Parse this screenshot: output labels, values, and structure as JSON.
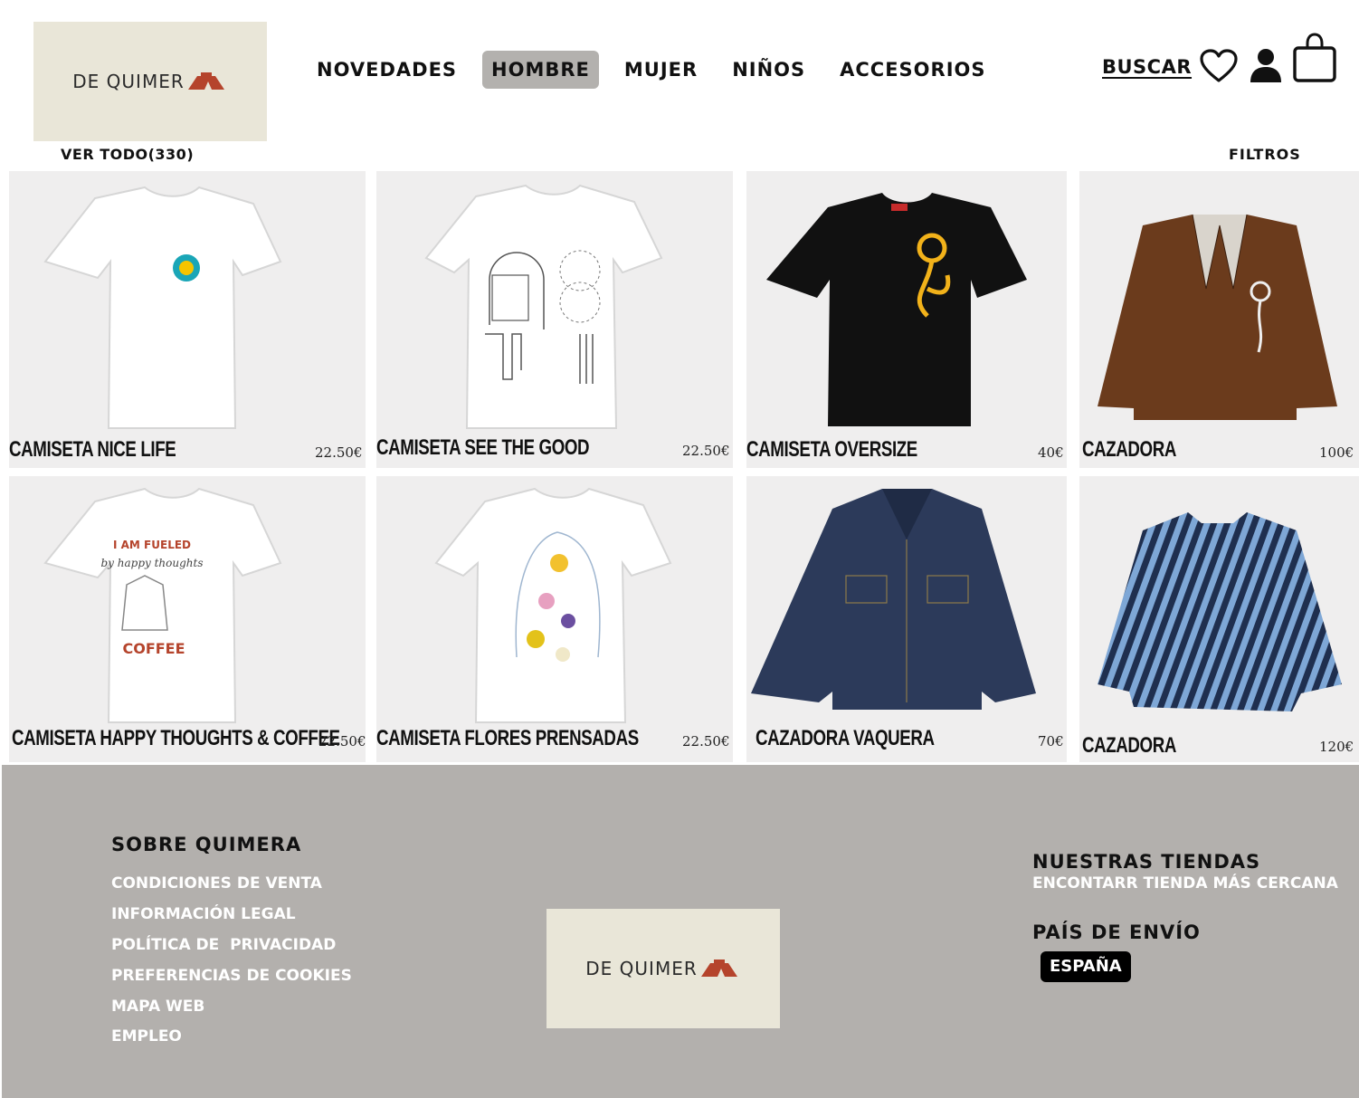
{
  "brand": {
    "logo_text": "DE QUIMER",
    "accent": "#b5442c",
    "logo_bg": "#e9e6d8"
  },
  "nav": {
    "items": [
      "NOVEDADES",
      "HOMBRE",
      "MUJER",
      "NIÑOS",
      "ACCESORIOS"
    ],
    "active": "HOMBRE"
  },
  "header": {
    "search_label": "BUSCAR",
    "icons": [
      "heart-icon",
      "user-icon",
      "shopping-bag-icon"
    ]
  },
  "listing": {
    "view_all_label": "VER TODO(330)",
    "filters_label": "FILTROS"
  },
  "products": [
    {
      "name": "CAMISETA NICE LIFE",
      "price": "22.50€",
      "image": "white-tshirt-smiley-badge"
    },
    {
      "name": "CAMISETA SEE THE GOOD",
      "price": "22.50€",
      "image": "white-tshirt-see-the-good-print"
    },
    {
      "name": "CAMISETA OVERSIZE",
      "price": "40€",
      "image": "black-tshirt-yellow-flower"
    },
    {
      "name": "CAZADORA",
      "price": "100€",
      "image": "brown-jacket-flower"
    },
    {
      "name": "CAMISETA HAPPY THOUGHTS & COFFEE",
      "price": "22.50€",
      "image": "white-tshirt-coffee-print"
    },
    {
      "name": "CAMISETA FLORES PRENSADAS",
      "price": "22.50€",
      "image": "white-tshirt-pressed-flowers"
    },
    {
      "name": "CAZADORA VAQUERA",
      "price": "70€",
      "image": "denim-jacket"
    },
    {
      "name": "CAZADORA",
      "price": "120€",
      "image": "striped-denim-jacket"
    }
  ],
  "footer": {
    "about_title": "SOBRE QUIMERA",
    "links": [
      "CONDICIONES DE VENTA",
      "INFORMACIÓN LEGAL",
      "POLÍTICA DE  PRIVACIDAD",
      "PREFERENCIAS DE COOKIES",
      "MAPA WEB",
      "EMPLEO"
    ],
    "stores_title": "NUESTRAS TIENDAS",
    "stores_link": "ENCONTARR TIENDA MÁS CERCANA",
    "ship_title": "PAÍS DE ENVÍO",
    "country": "ESPAÑA"
  }
}
